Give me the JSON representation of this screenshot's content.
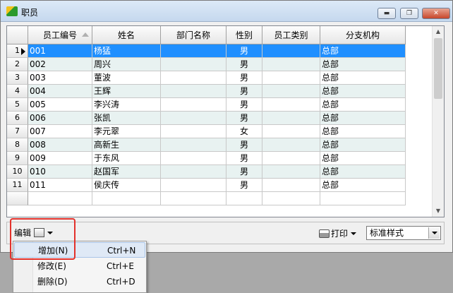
{
  "window": {
    "title": "职员",
    "minimize_glyph": "▬",
    "restore_glyph": "❐",
    "close_glyph": "✕"
  },
  "grid": {
    "columns": [
      "员工编号",
      "姓名",
      "部门名称",
      "性别",
      "员工类别",
      "分支机构"
    ],
    "rows": [
      {
        "no": "1",
        "id": "001",
        "name": "杨猛",
        "dept": "",
        "gender": "男",
        "type": "",
        "branch": "总部"
      },
      {
        "no": "2",
        "id": "002",
        "name": "周兴",
        "dept": "",
        "gender": "男",
        "type": "",
        "branch": "总部"
      },
      {
        "no": "3",
        "id": "003",
        "name": "董波",
        "dept": "",
        "gender": "男",
        "type": "",
        "branch": "总部"
      },
      {
        "no": "4",
        "id": "004",
        "name": "王辉",
        "dept": "",
        "gender": "男",
        "type": "",
        "branch": "总部"
      },
      {
        "no": "5",
        "id": "005",
        "name": "李兴涛",
        "dept": "",
        "gender": "男",
        "type": "",
        "branch": "总部"
      },
      {
        "no": "6",
        "id": "006",
        "name": "张凯",
        "dept": "",
        "gender": "男",
        "type": "",
        "branch": "总部"
      },
      {
        "no": "7",
        "id": "007",
        "name": "李元翠",
        "dept": "",
        "gender": "女",
        "type": "",
        "branch": "总部"
      },
      {
        "no": "8",
        "id": "008",
        "name": "高新生",
        "dept": "",
        "gender": "男",
        "type": "",
        "branch": "总部"
      },
      {
        "no": "9",
        "id": "009",
        "name": "于东风",
        "dept": "",
        "gender": "男",
        "type": "",
        "branch": "总部"
      },
      {
        "no": "10",
        "id": "010",
        "name": "赵国军",
        "dept": "",
        "gender": "男",
        "type": "",
        "branch": "总部"
      },
      {
        "no": "11",
        "id": "011",
        "name": "侯庆传",
        "dept": "",
        "gender": "男",
        "type": "",
        "branch": "总部"
      }
    ],
    "selected_row": 1
  },
  "toolbar": {
    "edit_label": "编辑",
    "print_label": "打印",
    "style_select_value": "标准样式"
  },
  "edit_menu": {
    "items": [
      {
        "label": "增加(N)",
        "shortcut": "Ctrl+N"
      },
      {
        "label": "修改(E)",
        "shortcut": "Ctrl+E"
      },
      {
        "label": "删除(D)",
        "shortcut": "Ctrl+D"
      }
    ]
  },
  "colors": {
    "selection": "#1f8fff",
    "alt_row": "#e8f2f1",
    "highlight_box": "#e3312b"
  }
}
